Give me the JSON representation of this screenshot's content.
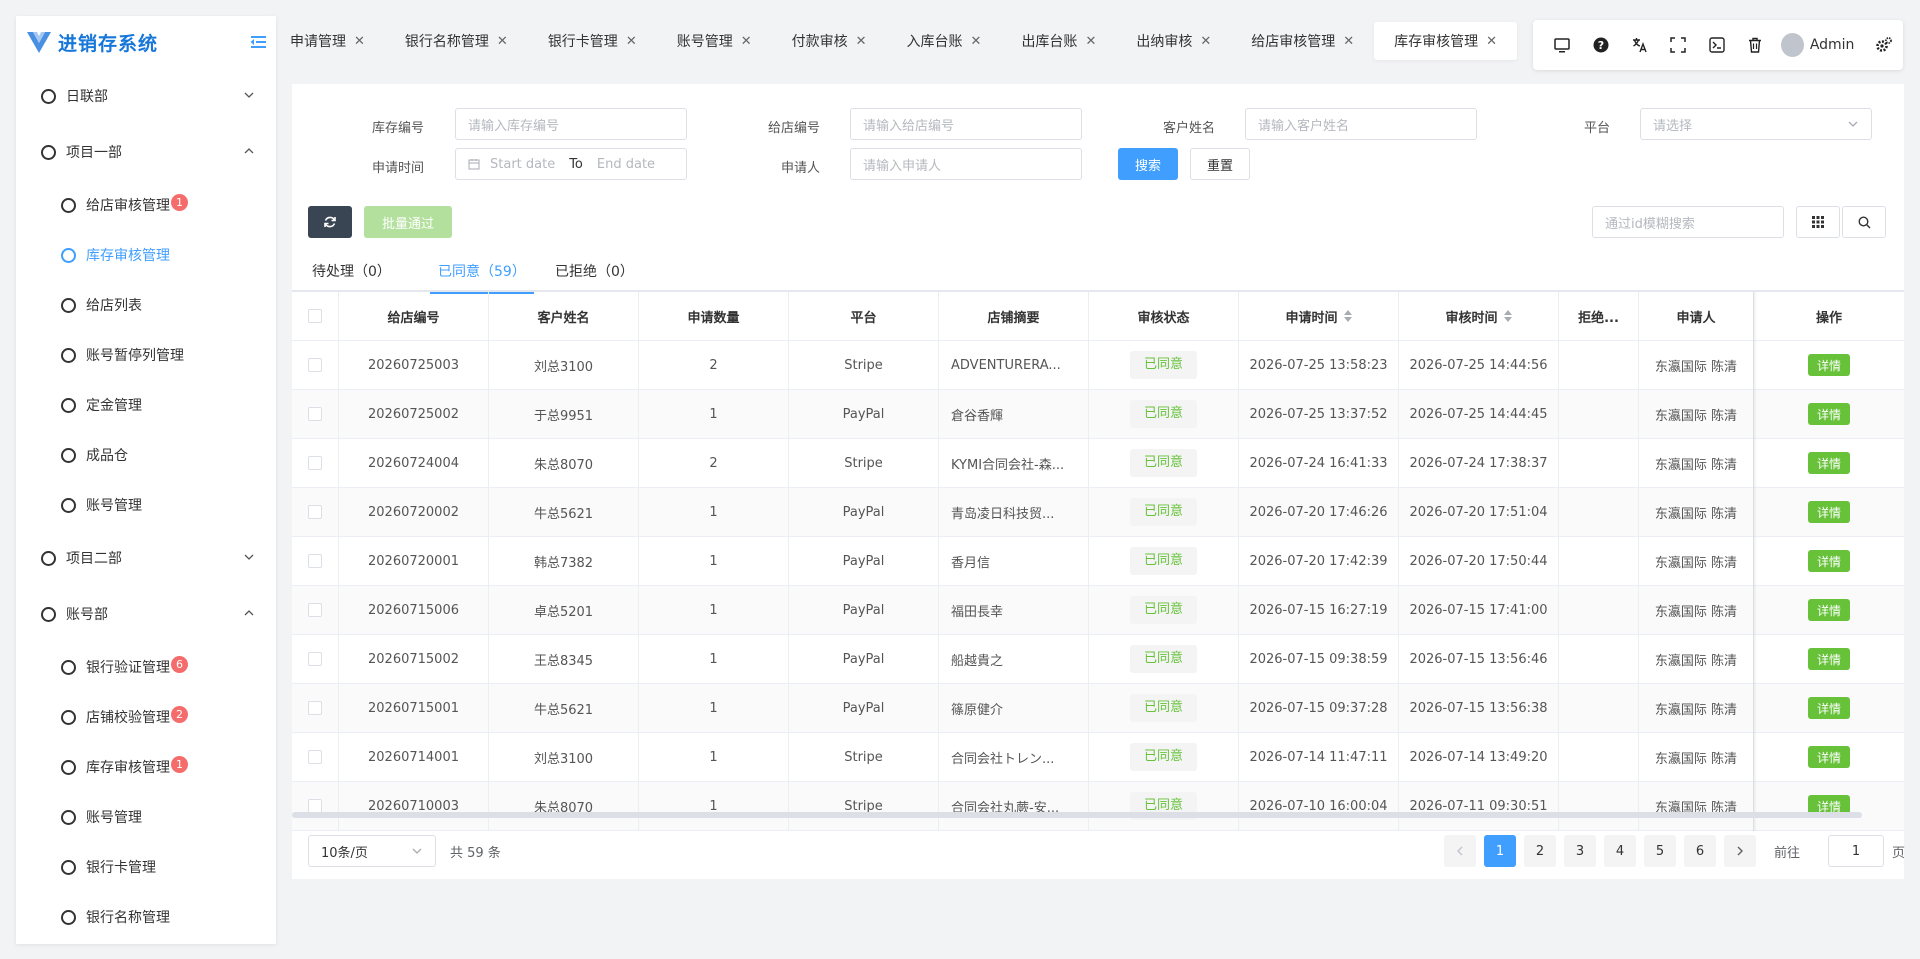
{
  "app": {
    "title": "进销存系统"
  },
  "sidebar": {
    "groups": [
      {
        "label": "日联部",
        "expanded": false
      },
      {
        "label": "项目一部",
        "expanded": true,
        "items": [
          {
            "label": "给店审核管理",
            "badge": "1"
          },
          {
            "label": "库存审核管理",
            "active": true
          },
          {
            "label": "给店列表"
          },
          {
            "label": "账号暂停列管理"
          },
          {
            "label": "定金管理"
          },
          {
            "label": "成品仓"
          },
          {
            "label": "账号管理"
          }
        ]
      },
      {
        "label": "项目二部",
        "expanded": false
      },
      {
        "label": "账号部",
        "expanded": true,
        "items": [
          {
            "label": "银行验证管理",
            "badge": "6"
          },
          {
            "label": "店铺校验管理",
            "badge": "2"
          },
          {
            "label": "库存审核管理",
            "badge": "1"
          },
          {
            "label": "账号管理"
          },
          {
            "label": "银行卡管理"
          },
          {
            "label": "银行名称管理"
          }
        ]
      }
    ]
  },
  "tabs": [
    {
      "label": "申请管理"
    },
    {
      "label": "银行名称管理"
    },
    {
      "label": "银行卡管理"
    },
    {
      "label": "账号管理"
    },
    {
      "label": "付款审核"
    },
    {
      "label": "入库台账"
    },
    {
      "label": "出库台账"
    },
    {
      "label": "出纳审核"
    },
    {
      "label": "给店审核管理"
    },
    {
      "label": "库存审核管理",
      "active": true
    }
  ],
  "toolbar": {
    "user": "Admin"
  },
  "filters": {
    "stock_no_label": "库存编号",
    "stock_no_placeholder": "请输入库存编号",
    "shop_no_label": "给店编号",
    "shop_no_placeholder": "请输入给店编号",
    "customer_label": "客户姓名",
    "customer_placeholder": "请输入客户姓名",
    "platform_label": "平台",
    "platform_placeholder": "请选择",
    "apply_time_label": "申请时间",
    "start_placeholder": "Start date",
    "to": "To",
    "end_placeholder": "End date",
    "applicant_label": "申请人",
    "applicant_placeholder": "请输入申请人",
    "search_btn": "搜索",
    "reset_btn": "重置"
  },
  "actions": {
    "batch_approve": "批量通过",
    "id_search_placeholder": "通过id模糊搜索"
  },
  "subtabs": [
    {
      "label": "待处理（0）"
    },
    {
      "label": "已同意（59）",
      "active": true
    },
    {
      "label": "已拒绝（0）"
    }
  ],
  "table": {
    "columns": [
      "给店编号",
      "客户姓名",
      "申请数量",
      "平台",
      "店铺摘要",
      "审核状态",
      "申请时间",
      "审核时间",
      "拒绝...",
      "申请人",
      "操作"
    ],
    "rows": [
      {
        "id": "20260725003",
        "customer": "刘总3100",
        "qty": "2",
        "platform": "Stripe",
        "shop": "ADVENTURERA...",
        "status": "已同意",
        "apply": "2026-07-25 13:58:23",
        "review": "2026-07-25 14:44:56",
        "reject": "",
        "applicant": "东瀛国际 陈清",
        "op": "详情"
      },
      {
        "id": "20260725002",
        "customer": "于总9951",
        "qty": "1",
        "platform": "PayPal",
        "shop": "倉谷香輝",
        "status": "已同意",
        "apply": "2026-07-25 13:37:52",
        "review": "2026-07-25 14:44:45",
        "reject": "",
        "applicant": "东瀛国际 陈清",
        "op": "详情"
      },
      {
        "id": "20260724004",
        "customer": "朱总8070",
        "qty": "2",
        "platform": "Stripe",
        "shop": "KYMI合同会社-森...",
        "status": "已同意",
        "apply": "2026-07-24 16:41:33",
        "review": "2026-07-24 17:38:37",
        "reject": "",
        "applicant": "东瀛国际 陈清",
        "op": "详情"
      },
      {
        "id": "20260720002",
        "customer": "牛总5621",
        "qty": "1",
        "platform": "PayPal",
        "shop": "青岛凌日科技贸...",
        "status": "已同意",
        "apply": "2026-07-20 17:46:26",
        "review": "2026-07-20 17:51:04",
        "reject": "",
        "applicant": "东瀛国际 陈清",
        "op": "详情"
      },
      {
        "id": "20260720001",
        "customer": "韩总7382",
        "qty": "1",
        "platform": "PayPal",
        "shop": "香月信",
        "status": "已同意",
        "apply": "2026-07-20 17:42:39",
        "review": "2026-07-20 17:50:44",
        "reject": "",
        "applicant": "东瀛国际 陈清",
        "op": "详情"
      },
      {
        "id": "20260715006",
        "customer": "卓总5201",
        "qty": "1",
        "platform": "PayPal",
        "shop": "福田長幸",
        "status": "已同意",
        "apply": "2026-07-15 16:27:19",
        "review": "2026-07-15 17:41:00",
        "reject": "",
        "applicant": "东瀛国际 陈清",
        "op": "详情"
      },
      {
        "id": "20260715002",
        "customer": "王总8345",
        "qty": "1",
        "platform": "PayPal",
        "shop": "船越貴之",
        "status": "已同意",
        "apply": "2026-07-15 09:38:59",
        "review": "2026-07-15 13:56:46",
        "reject": "",
        "applicant": "东瀛国际 陈清",
        "op": "详情"
      },
      {
        "id": "20260715001",
        "customer": "牛总5621",
        "qty": "1",
        "platform": "PayPal",
        "shop": "篠原健介",
        "status": "已同意",
        "apply": "2026-07-15 09:37:28",
        "review": "2026-07-15 13:56:38",
        "reject": "",
        "applicant": "东瀛国际 陈清",
        "op": "详情"
      },
      {
        "id": "20260714001",
        "customer": "刘总3100",
        "qty": "1",
        "platform": "Stripe",
        "shop": "合同会社トレン...",
        "status": "已同意",
        "apply": "2026-07-14 11:47:11",
        "review": "2026-07-14 13:49:20",
        "reject": "",
        "applicant": "东瀛国际 陈清",
        "op": "详情"
      },
      {
        "id": "20260710003",
        "customer": "朱总8070",
        "qty": "1",
        "platform": "Stripe",
        "shop": "合同会社丸蕨-安...",
        "status": "已同意",
        "apply": "2026-07-10 16:00:04",
        "review": "2026-07-11 09:30:51",
        "reject": "",
        "applicant": "东瀛国际 陈清",
        "op": "详情"
      }
    ]
  },
  "pagination": {
    "page_size": "10条/页",
    "total": "共 59 条",
    "pages": [
      "1",
      "2",
      "3",
      "4",
      "5",
      "6"
    ],
    "current": "1",
    "goto_label": "前往",
    "goto_value": "1",
    "page_suffix": "页"
  },
  "colors": {
    "primary": "#409eff",
    "success": "#67c23a",
    "danger": "#f56c6c",
    "dark_btn": "#3a4553"
  }
}
